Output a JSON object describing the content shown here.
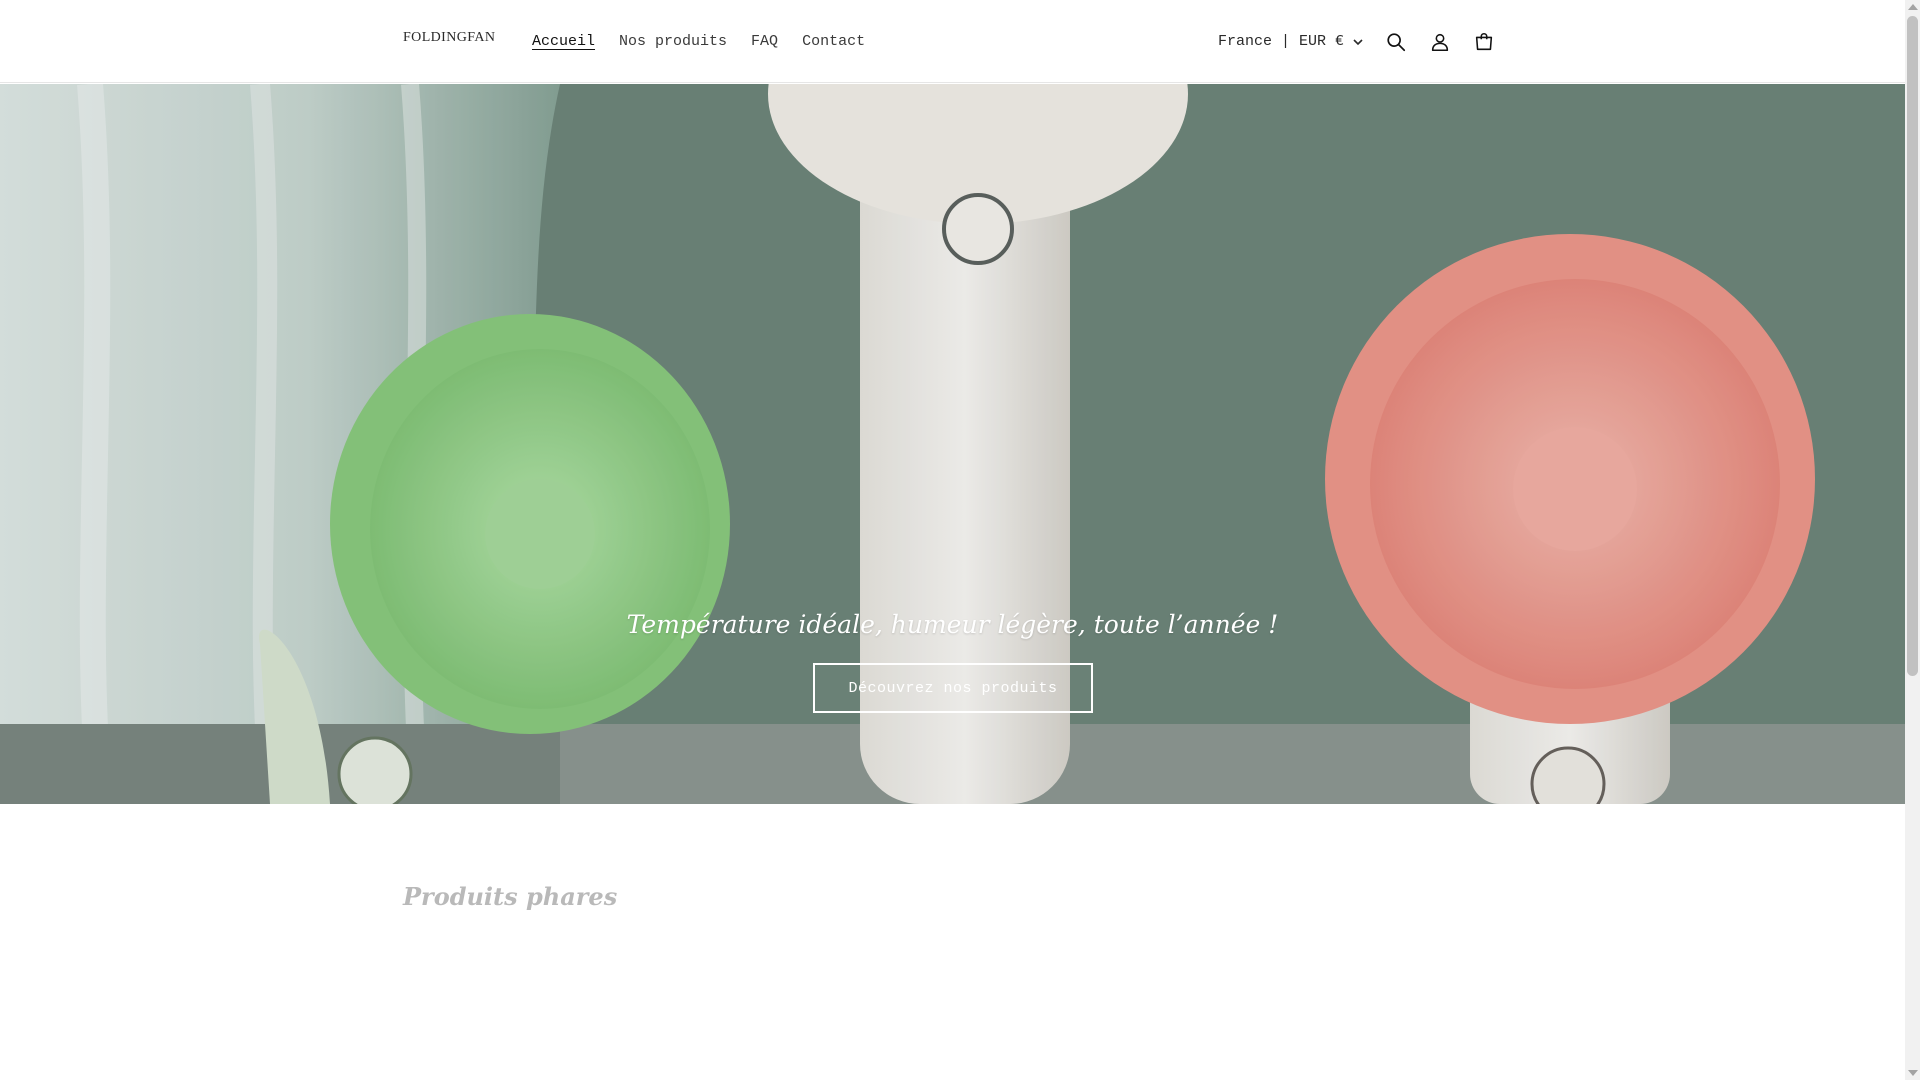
{
  "brand": {
    "logo_text": "FOLDINGFAN"
  },
  "nav": {
    "items": [
      {
        "label": "Accueil",
        "active": true
      },
      {
        "label": "Nos produits",
        "active": false
      },
      {
        "label": "FAQ",
        "active": false
      },
      {
        "label": "Contact",
        "active": false
      }
    ]
  },
  "header": {
    "locale_label": "France | EUR €",
    "icons": [
      "search-icon",
      "account-icon",
      "cart-icon"
    ]
  },
  "hero": {
    "tagline": "Température idéale, humeur légère, toute l’année !",
    "cta_label": "Découvrez nos produits",
    "colors": {
      "wall": "#6f877c",
      "curtain": "#d6e3df",
      "fan_green": "#9fd796",
      "fan_pink": "#f1a397",
      "handle": "#f2f0ec"
    }
  },
  "featured": {
    "title": "Produits phares"
  }
}
